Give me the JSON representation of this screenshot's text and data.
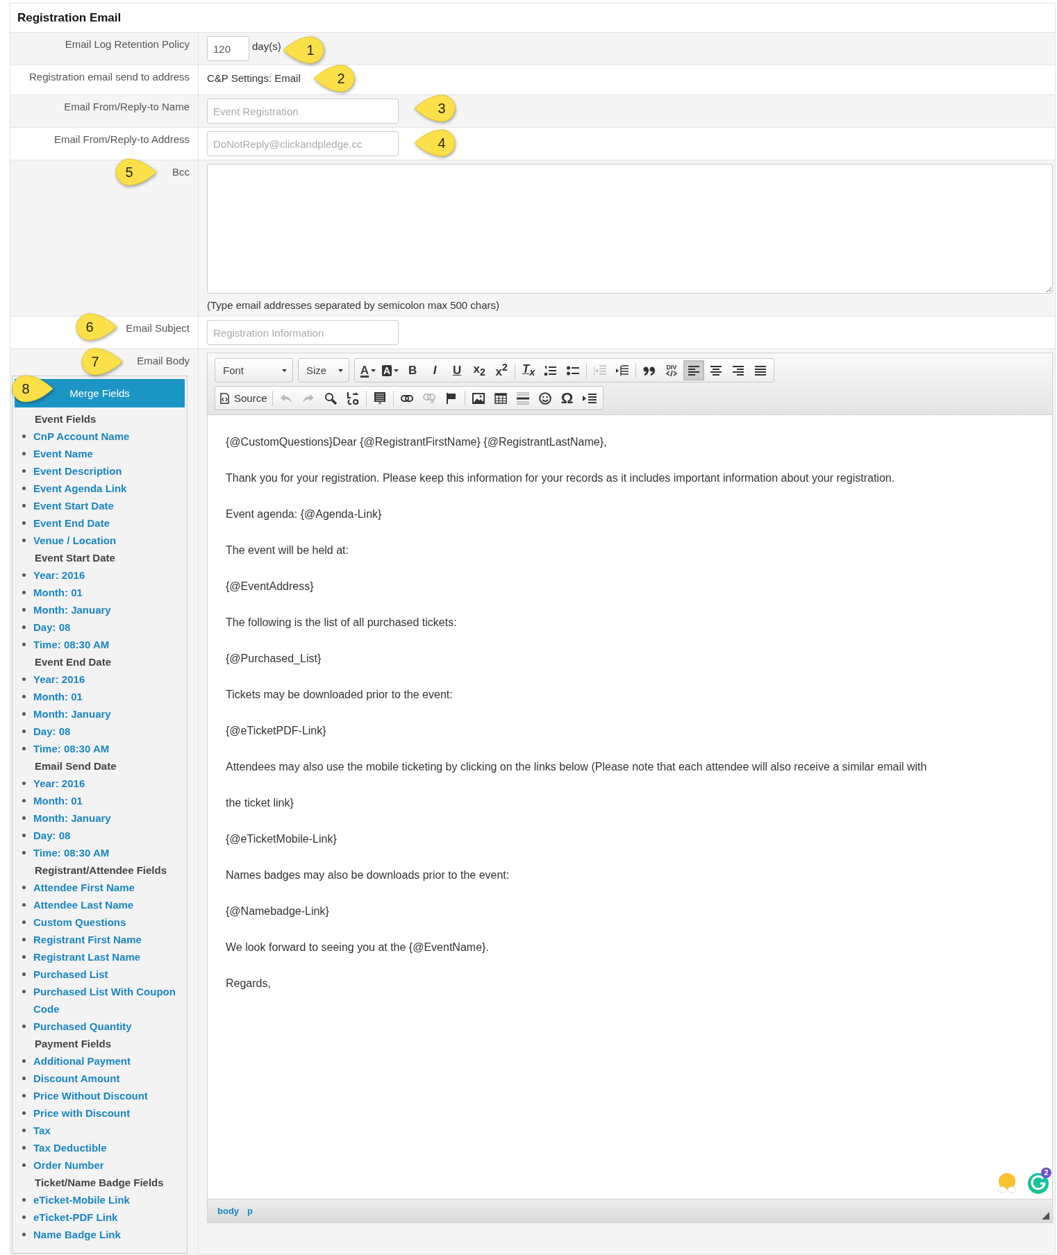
{
  "title": "Registration Email",
  "fields": [
    {
      "kind": "number",
      "label": "Email Log Retention Policy",
      "value": "120",
      "unit": "day(s)"
    },
    {
      "kind": "static",
      "label": "Registration email send to address",
      "value": "C&P Settings: Email"
    },
    {
      "kind": "text",
      "label": "Email From/Reply-to Name",
      "placeholder": "Event Registration"
    },
    {
      "kind": "text",
      "label": "Email From/Reply-to Address",
      "placeholder": "DoNotReply@clickandpledge.cc"
    },
    {
      "kind": "textarea",
      "label": "Bcc",
      "hint": "(Type email addresses separated by semicolon max 500 chars)"
    },
    {
      "kind": "text",
      "label": "Email Subject",
      "placeholder": "Registration Information"
    },
    {
      "kind": "editor",
      "label": "Email Body"
    }
  ],
  "merge_fields": {
    "title": "Merge Fields",
    "groups": [
      {
        "heading": "Event Fields",
        "items": [
          "CnP Account Name",
          "Event Name",
          "Event Description",
          "Event Agenda Link",
          "Event Start Date",
          "Event End Date",
          "Venue / Location"
        ]
      },
      {
        "heading": "Event Start Date",
        "items": [
          "Year: 2016",
          "Month: 01",
          "Month: January",
          "Day: 08",
          "Time: 08:30 AM"
        ]
      },
      {
        "heading": "Event End Date",
        "items": [
          "Year: 2016",
          "Month: 01",
          "Month: January",
          "Day: 08",
          "Time: 08:30 AM"
        ]
      },
      {
        "heading": "Email Send Date",
        "items": [
          "Year: 2016",
          "Month: 01",
          "Month: January",
          "Day: 08",
          "Time: 08:30 AM"
        ]
      },
      {
        "heading": "Registrant/Attendee Fields",
        "items": [
          "Attendee First Name",
          "Attendee Last Name",
          "Custom Questions",
          "Registrant First Name",
          "Registrant Last Name",
          "Purchased List",
          "Purchased List With Coupon Code",
          "Purchased Quantity"
        ]
      },
      {
        "heading": "Payment Fields",
        "items": [
          "Additional Payment",
          "Discount Amount",
          "Price Without Discount",
          "Price with Discount",
          "Tax",
          "Tax Deductible",
          "Order Number"
        ]
      },
      {
        "heading": "Ticket/Name Badge Fields",
        "items": [
          "eTicket-Mobile Link",
          "eTicket-PDF Link",
          "Name Badge Link"
        ]
      }
    ]
  },
  "email_body": {
    "toolbar": [
      [
        {
          "kind": "dropdown",
          "label": "Font"
        },
        {
          "kind": "dropdown",
          "label": "Size"
        },
        {
          "kind": "group",
          "buttons": [
            {
              "kind": "button",
              "label": "A",
              "disabled": false,
              "selected": false
            },
            {
              "kind": "button",
              "label": "A",
              "disabled": false,
              "selected": false
            },
            {
              "kind": "button",
              "label": "B",
              "disabled": false,
              "selected": false
            },
            {
              "kind": "button",
              "label": "I",
              "disabled": false,
              "selected": false
            },
            {
              "kind": "button",
              "label": "U",
              "disabled": false,
              "selected": false
            },
            {
              "kind": "button",
              "label": "x$_{2}$",
              "disabled": false,
              "selected": false
            },
            {
              "kind": "button",
              "label": "x$^{2}$",
              "disabled": false,
              "selected": false
            },
            {
              "kind": "separator"
            },
            {
              "kind": "button",
              "label": "T$_{x}$",
              "disabled": false,
              "selected": false
            },
            {
              "kind": "button",
              "disabled": false,
              "selected": false
            },
            {
              "kind": "button",
              "disabled": false,
              "selected": false
            },
            {
              "kind": "separator"
            },
            {
              "kind": "button",
              "disabled": true,
              "selected": false
            },
            {
              "kind": "button",
              "disabled": false,
              "selected": false
            },
            {
              "kind": "separator"
            },
            {
              "kind": "button",
              "disabled": false,
              "selected": false
            },
            {
              "kind": "button",
              "label": "DIV",
              "disabled": false,
              "selected": false
            },
            {
              "kind": "button",
              "disabled": false,
              "selected": true
            },
            {
              "kind": "button",
              "disabled": false,
              "selected": false
            },
            {
              "kind": "button",
              "disabled": false,
              "selected": false
            },
            {
              "kind": "button",
              "disabled": false,
              "selected": false
            }
          ]
        }
      ],
      [
        {
          "kind": "group",
          "buttons": [
            {
              "kind": "button",
              "label": "Source",
              "disabled": false,
              "selected": false
            },
            {
              "kind": "separator"
            },
            {
              "kind": "button",
              "disabled": true,
              "selected": false
            },
            {
              "kind": "button",
              "disabled": true,
              "selected": false
            },
            {
              "kind": "button",
              "disabled": false,
              "selected": false
            },
            {
              "kind": "button",
              "disabled": false,
              "selected": false
            },
            {
              "kind": "separator"
            },
            {
              "kind": "button",
              "disabled": false,
              "selected": false
            },
            {
              "kind": "separator"
            },
            {
              "kind": "button",
              "disabled": false,
              "selected": false
            },
            {
              "kind": "button",
              "disabled": true,
              "selected": false
            },
            {
              "kind": "button",
              "disabled": false,
              "selected": false
            },
            {
              "kind": "separator"
            },
            {
              "kind": "button",
              "disabled": false,
              "selected": false
            },
            {
              "kind": "button",
              "disabled": false,
              "selected": false
            },
            {
              "kind": "button",
              "disabled": false,
              "selected": false
            },
            {
              "kind": "button",
              "disabled": false,
              "selected": false
            },
            {
              "kind": "button",
              "label": "Ω",
              "disabled": false,
              "selected": false
            },
            {
              "kind": "button",
              "disabled": false,
              "selected": false
            }
          ]
        }
      ]
    ],
    "paragraphs": [
      "{@CustomQuestions}Dear {@RegistrantFirstName} {@RegistrantLastName},",
      "Thank you for your registration. Please keep this information for your records as it includes important information about your registration.",
      "Event agenda: {@Agenda-Link}",
      "The event will be held at:",
      "{@EventAddress}",
      "The following is the list of all purchased tickets:",
      "{@Purchased_List}",
      "Tickets may be downloaded prior to the event:",
      "{@eTicketPDF-Link}",
      "Attendees may also use the mobile ticketing by clicking on the links below (Please note that each attendee will also receive a similar email with",
      "the ticket link}",
      "{@eTicketMobile-Link}",
      "Names badges may also be downloads prior to the event:",
      "{@Namebadge-Link}",
      "We look forward to seeing you at the {@EventName}.",
      "Regards,"
    ],
    "grammar_badge": "2",
    "status_path": [
      "body",
      "p"
    ]
  },
  "callouts": [
    {
      "number": "1",
      "kind": "left"
    },
    {
      "number": "2",
      "kind": "left"
    },
    {
      "number": "3",
      "kind": "left"
    },
    {
      "number": "4",
      "kind": "left"
    },
    {
      "number": "5",
      "kind": "right"
    },
    {
      "number": "6",
      "kind": "right"
    },
    {
      "number": "7",
      "kind": "right"
    },
    {
      "number": "8",
      "kind": "right"
    }
  ]
}
